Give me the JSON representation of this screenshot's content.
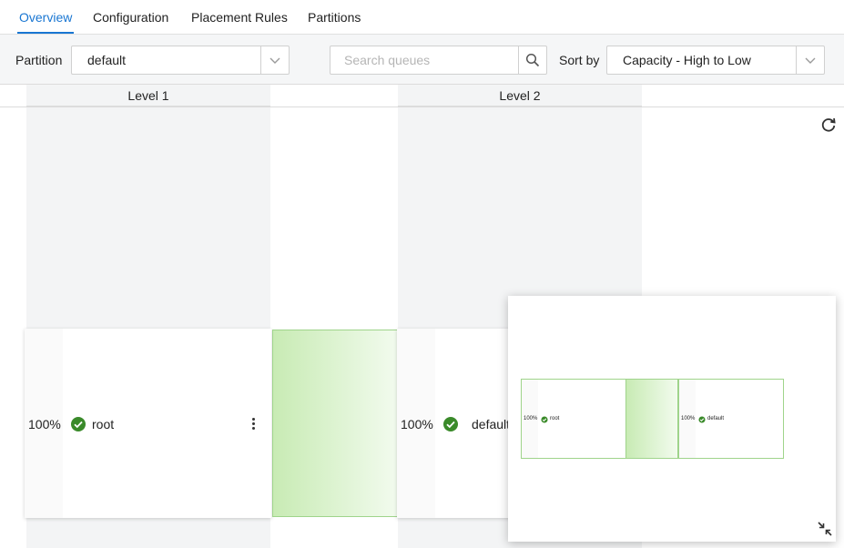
{
  "tabs": [
    {
      "label": "Overview",
      "active": true
    },
    {
      "label": "Configuration",
      "active": false
    },
    {
      "label": "Placement Rules",
      "active": false
    },
    {
      "label": "Partitions",
      "active": false
    }
  ],
  "toolbar": {
    "partition_label": "Partition",
    "partition_value": "default",
    "search_placeholder": "Search queues",
    "search_value": "",
    "sort_label": "Sort by",
    "sort_value": "Capacity - High to Low"
  },
  "levels": [
    {
      "label": "Level 1"
    },
    {
      "label": "Level 2"
    }
  ],
  "queues": [
    {
      "name": "root",
      "capacity": "100%",
      "status": "healthy"
    },
    {
      "name": "default",
      "capacity": "100%",
      "status": "healthy"
    }
  ],
  "icons": {
    "search": "search-icon",
    "chevron": "chevron-down-icon",
    "refresh": "refresh-icon",
    "status": "check-circle-icon",
    "menu": "more-vertical-icon",
    "collapse": "collapse-icon"
  },
  "colors": {
    "accent": "#1976d2",
    "status_ok": "#3a8a2a",
    "connector": "#c8ebb4"
  }
}
